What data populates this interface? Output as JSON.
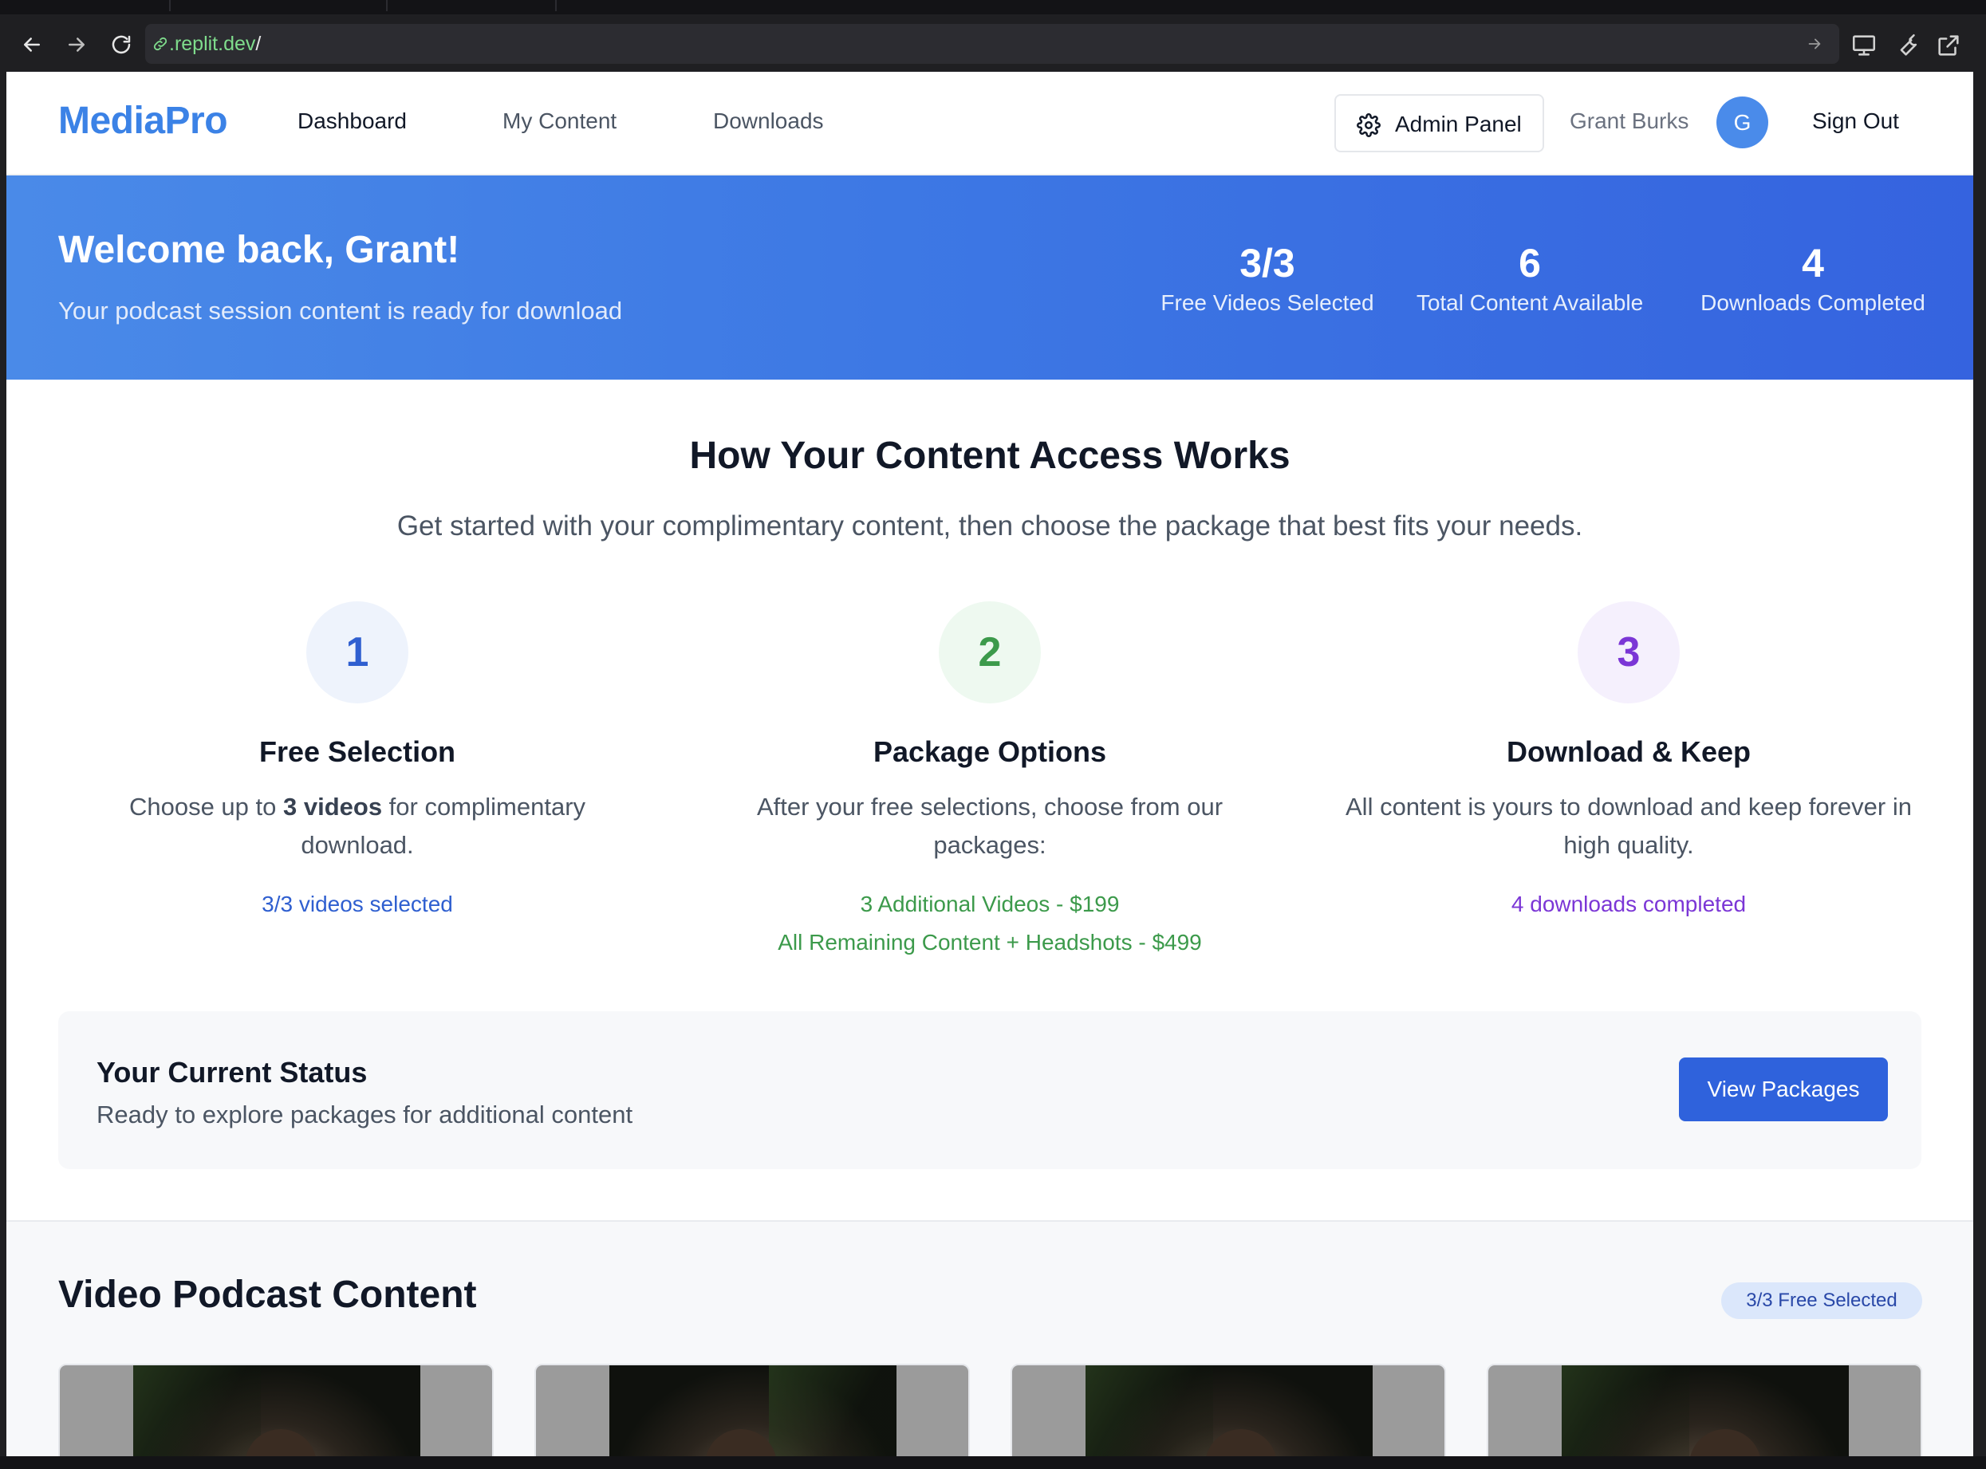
{
  "browser": {
    "url_host": ".replit.dev",
    "url_path": "/"
  },
  "header": {
    "logo": "MediaPro",
    "nav": [
      "Dashboard",
      "My Content",
      "Downloads"
    ],
    "admin_button": "Admin Panel",
    "user_name": "Grant Burks",
    "avatar_initial": "G",
    "sign_out": "Sign Out"
  },
  "banner": {
    "title": "Welcome back, Grant!",
    "subtitle": "Your podcast session content is ready for download",
    "stats": [
      {
        "value": "3/3",
        "label": "Free Videos Selected"
      },
      {
        "value": "6",
        "label": "Total Content Available"
      },
      {
        "value": "4",
        "label": "Downloads Completed"
      }
    ]
  },
  "how": {
    "title": "How Your Content Access Works",
    "subtitle": "Get started with your complimentary content, then choose the package that best fits your needs.",
    "steps": [
      {
        "number": "1",
        "title": "Free Selection",
        "desc_before": "Choose up to ",
        "desc_bold": "3 videos",
        "desc_after": " for complimentary download.",
        "notes": [
          "3/3 videos selected"
        ],
        "color": "#2f5fd0",
        "bg": "#eef3fc"
      },
      {
        "number": "2",
        "title": "Package Options",
        "desc_before": "After your free selections, choose from our packages:",
        "desc_bold": "",
        "desc_after": "",
        "notes": [
          "3 Additional Videos - $199",
          "All Remaining Content + Headshots - $499"
        ],
        "color": "#3c9a4b",
        "bg": "#eef9f0"
      },
      {
        "number": "3",
        "title": "Download & Keep",
        "desc_before": "All content is yours to download and keep forever in high quality.",
        "desc_bold": "",
        "desc_after": "",
        "notes": [
          "4 downloads completed"
        ],
        "color": "#7b36d6",
        "bg": "#f5f0fd"
      }
    ]
  },
  "status": {
    "title": "Your Current Status",
    "text": "Ready to explore packages for additional content",
    "button": "View Packages"
  },
  "videos": {
    "title": "Video Podcast Content",
    "badge": "3/3 Free Selected"
  }
}
